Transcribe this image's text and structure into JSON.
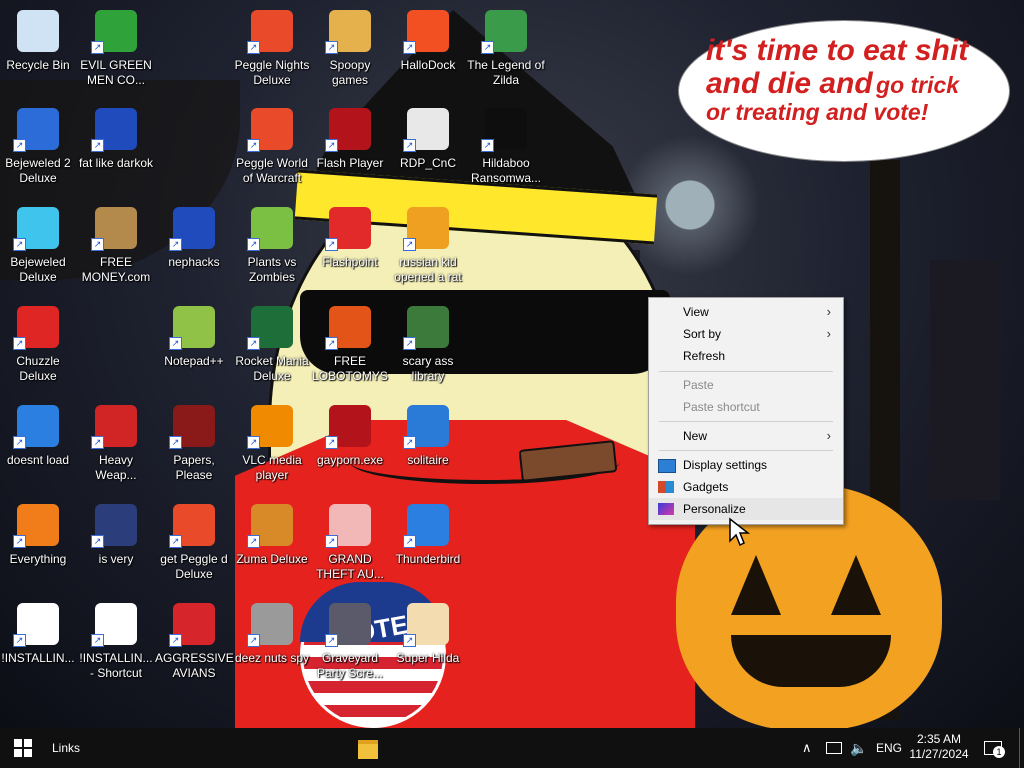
{
  "desktop": {
    "icons": [
      {
        "label": "Recycle Bin",
        "icon": "recycle-bin-icon",
        "color": "#cfe3f5"
      },
      {
        "label": "EVIL GREEN MEN CO...",
        "icon": "people-icon",
        "color": "#2fa33a"
      },
      {
        "label": "Peggle Nights Deluxe",
        "icon": "peggle-icon",
        "color": "#e94a2a"
      },
      {
        "label": "Spoopy games",
        "icon": "folder-icon",
        "color": "#e5b14d"
      },
      {
        "label": "HalloDock",
        "icon": "windows-flag-icon",
        "color": "#f25022"
      },
      {
        "label": "The Legend of Zilda",
        "icon": "link-character-icon",
        "color": "#3a9b4a"
      },
      {
        "label": "Bejeweled 2 Deluxe",
        "icon": "gem-icon",
        "color": "#2b6cd8"
      },
      {
        "label": "fat like darkok",
        "icon": "mpl-logo-icon",
        "color": "#1f4bbd"
      },
      {
        "label": "Peggle World of Warcraft",
        "icon": "peggle-icon",
        "color": "#e94a2a"
      },
      {
        "label": "Flash Player",
        "icon": "flash-icon",
        "color": "#b3141b"
      },
      {
        "label": "RDP_CnC",
        "icon": "rdp-icon",
        "color": "#e8e8e8"
      },
      {
        "label": "Hildaboo Ransomwa...",
        "icon": "yashma-icon",
        "color": "#0e0e0e"
      },
      {
        "label": "Bejeweled Deluxe",
        "icon": "diamond-icon",
        "color": "#3fc4ee"
      },
      {
        "label": "FREE MONEY.com",
        "icon": "money-bag-icon",
        "color": "#b38a4c"
      },
      {
        "label": "nephacks",
        "icon": "mpi-logo-icon",
        "color": "#1f4bbd"
      },
      {
        "label": "Plants vs Zombies",
        "icon": "flower-icon",
        "color": "#7bc043"
      },
      {
        "label": "Flashpoint",
        "icon": "flashpoint-icon",
        "color": "#e22a2a"
      },
      {
        "label": "russian kid opened a rat",
        "icon": "de-logo-icon",
        "color": "#f0a020"
      },
      {
        "label": "Chuzzle Deluxe",
        "icon": "chuzzle-icon",
        "color": "#e02525"
      },
      {
        "label": "Notepad++",
        "icon": "notepad-plus-icon",
        "color": "#8fc247"
      },
      {
        "label": "Rocket Mania Deluxe",
        "icon": "rocket-icon",
        "color": "#1e6e3a"
      },
      {
        "label": "FREE LOBOTOMYS",
        "icon": "lobotomy-icon",
        "color": "#e25418"
      },
      {
        "label": "scary ass library",
        "icon": "library-icon",
        "color": "#3c7a3c"
      },
      {
        "label": "doesnt load",
        "icon": "thunderbird-icon",
        "color": "#2a7fe0"
      },
      {
        "label": "Heavy Weap...",
        "icon": "radiation-icon",
        "color": "#d12424"
      },
      {
        "label": "Papers, Please",
        "icon": "papers-please-icon",
        "color": "#8a1a1a"
      },
      {
        "label": "VLC media player",
        "icon": "vlc-cone-icon",
        "color": "#f08a00"
      },
      {
        "label": "gayporn.exe",
        "icon": "flash-icon",
        "color": "#b3141b"
      },
      {
        "label": "solitaire",
        "icon": "solitaire-icon",
        "color": "#2a7ad8"
      },
      {
        "label": "Everything",
        "icon": "magnifier-icon",
        "color": "#f07d1a"
      },
      {
        "label": "is very",
        "icon": "mpl-shield-icon",
        "color": "#2b3d7a"
      },
      {
        "label": "get Peggle d Deluxe",
        "icon": "peggle-icon",
        "color": "#e94a2a"
      },
      {
        "label": "Zuma Deluxe",
        "icon": "zuma-icon",
        "color": "#d88a28"
      },
      {
        "label": "GRAND THEFT AU...",
        "icon": "anime-girl-icon",
        "color": "#f2b7b7"
      },
      {
        "label": "Thunderbird",
        "icon": "thunderbird-icon",
        "color": "#2a7fe0"
      },
      {
        "label": "!INSTALLIN...",
        "icon": "text-file-icon",
        "color": "#ffffff"
      },
      {
        "label": "!INSTALLIN... - Shortcut",
        "icon": "text-file-icon",
        "color": "#ffffff"
      },
      {
        "label": "AGGRESSIVE AVIANS",
        "icon": "angry-bird-icon",
        "color": "#d6262b"
      },
      {
        "label": "deez nuts spy",
        "icon": "windows-stack-icon",
        "color": "#9a9a9a"
      },
      {
        "label": "Graveyard Party Scre...",
        "icon": "graveyard-icon",
        "color": "#5a5a6a"
      },
      {
        "label": "Super Hilda",
        "icon": "pixel-character-icon",
        "color": "#f2dcb0"
      }
    ]
  },
  "wallpaper": {
    "speech_line1": "it's time to eat shit",
    "speech_line2a": "and die and",
    "speech_line2b": "go trick",
    "speech_line3": "or treating and vote!",
    "vote_badge": "VOTE"
  },
  "context_menu": {
    "items": [
      {
        "label": "View",
        "submenu": true
      },
      {
        "label": "Sort by",
        "submenu": true
      },
      {
        "label": "Refresh"
      },
      {
        "label": "Paste",
        "disabled": true
      },
      {
        "label": "Paste shortcut",
        "disabled": true
      },
      {
        "label": "New",
        "submenu": true
      },
      {
        "label": "Display settings",
        "icon": "display-settings-icon"
      },
      {
        "label": "Gadgets",
        "icon": "gadgets-icon"
      },
      {
        "label": "Personalize",
        "icon": "personalize-icon",
        "highlighted": true
      }
    ]
  },
  "taskbar": {
    "links_label": "Links",
    "language": "ENG",
    "time": "2:35 AM",
    "date": "11/27/2024",
    "notification_count": "1"
  },
  "colors": {
    "taskbar_bg": "#101010",
    "menu_bg": "#f2f2f2",
    "speech_text": "#d21f1f"
  }
}
